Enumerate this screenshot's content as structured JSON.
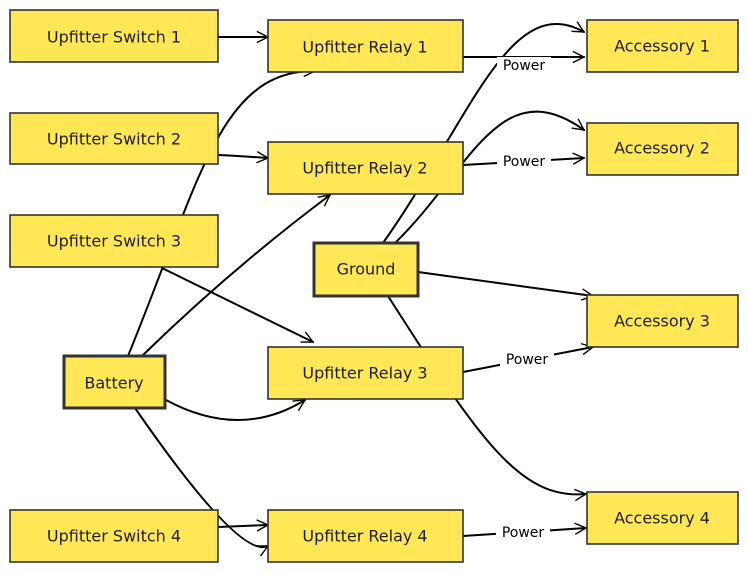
{
  "nodes": {
    "switch1": "Upfitter Switch 1",
    "switch2": "Upfitter Switch 2",
    "switch3": "Upfitter Switch 3",
    "switch4": "Upfitter Switch 4",
    "relay1": "Upfitter Relay 1",
    "relay2": "Upfitter Relay 2",
    "relay3": "Upfitter Relay 3",
    "relay4": "Upfitter Relay 4",
    "battery": "Battery",
    "ground": "Ground",
    "accessory1": "Accessory 1",
    "accessory2": "Accessory 2",
    "accessory3": "Accessory 3",
    "accessory4": "Accessory 4"
  },
  "edges": [
    {
      "from": "switch1",
      "to": "relay1",
      "label": ""
    },
    {
      "from": "switch2",
      "to": "relay2",
      "label": ""
    },
    {
      "from": "switch3",
      "to": "relay3",
      "label": ""
    },
    {
      "from": "switch4",
      "to": "relay4",
      "label": ""
    },
    {
      "from": "battery",
      "to": "relay1",
      "label": ""
    },
    {
      "from": "battery",
      "to": "relay2",
      "label": ""
    },
    {
      "from": "battery",
      "to": "relay3",
      "label": ""
    },
    {
      "from": "battery",
      "to": "relay4",
      "label": ""
    },
    {
      "from": "ground",
      "to": "accessory1",
      "label": ""
    },
    {
      "from": "ground",
      "to": "accessory2",
      "label": ""
    },
    {
      "from": "ground",
      "to": "accessory3",
      "label": ""
    },
    {
      "from": "ground",
      "to": "accessory4",
      "label": ""
    },
    {
      "from": "relay1",
      "to": "accessory1",
      "label": "Power"
    },
    {
      "from": "relay2",
      "to": "accessory2",
      "label": "Power"
    },
    {
      "from": "relay3",
      "to": "accessory3",
      "label": "Power"
    },
    {
      "from": "relay4",
      "to": "accessory4",
      "label": "Power"
    }
  ],
  "colors": {
    "node_fill": "#ffe756",
    "stroke": "#1e1e1e"
  }
}
